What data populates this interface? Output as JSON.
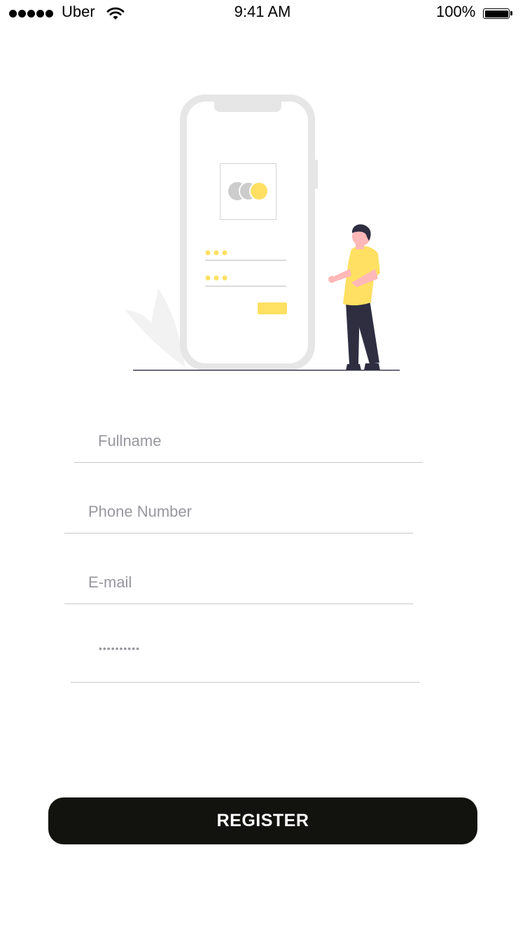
{
  "status_bar": {
    "carrier": "Uber",
    "time": "9:41 AM",
    "battery": "100%",
    "signal_bars": 5,
    "icons": [
      "signal-dots-icon",
      "wifi-icon",
      "battery-icon"
    ]
  },
  "illustration": {
    "name": "registration-illustration",
    "accent_color": "#FFE063",
    "phone_frame_color": "#E6E6E6",
    "shirt_color": "#FFE063",
    "pants_color": "#2F2E41",
    "skin_color": "#FFB8B8",
    "ground_color": "#3F3D56"
  },
  "form": {
    "fullname_placeholder": "Fullname",
    "phone_placeholder": "Phone Number",
    "email_placeholder": "E-mail",
    "password_mask": "••••••••••"
  },
  "register_button": {
    "label": "REGISTER",
    "background": "#12120E",
    "text_color": "#FFFFFF"
  }
}
